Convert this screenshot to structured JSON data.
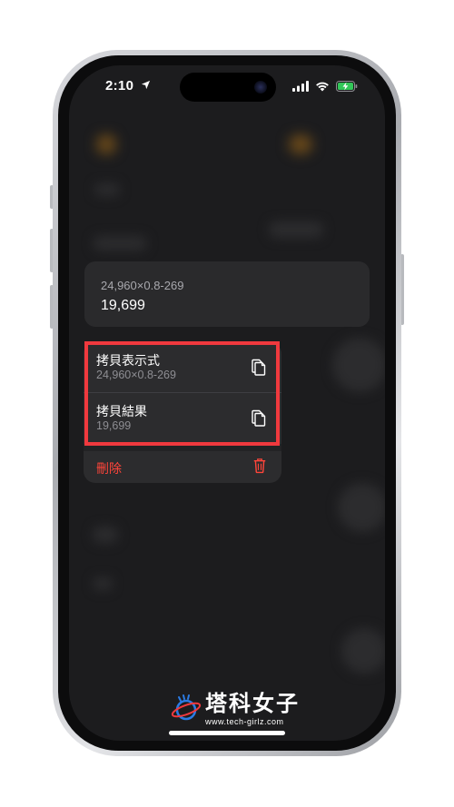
{
  "status_bar": {
    "time": "2:10"
  },
  "expression_card": {
    "expression": "24,960×0.8-269",
    "result": "19,699"
  },
  "context_menu": {
    "items": [
      {
        "title": "拷貝表示式",
        "subtitle": "24,960×0.8-269",
        "icon": "copy-icon"
      },
      {
        "title": "拷貝結果",
        "subtitle": "19,699",
        "icon": "copy-icon"
      }
    ],
    "delete": {
      "label": "刪除",
      "icon": "trash-icon"
    }
  },
  "watermark": {
    "title": "塔科女子",
    "url": "www.tech-girlz.com"
  },
  "colors": {
    "destructive": "#ff453a",
    "highlight": "#f0393e",
    "background": "#1c1c1e"
  }
}
